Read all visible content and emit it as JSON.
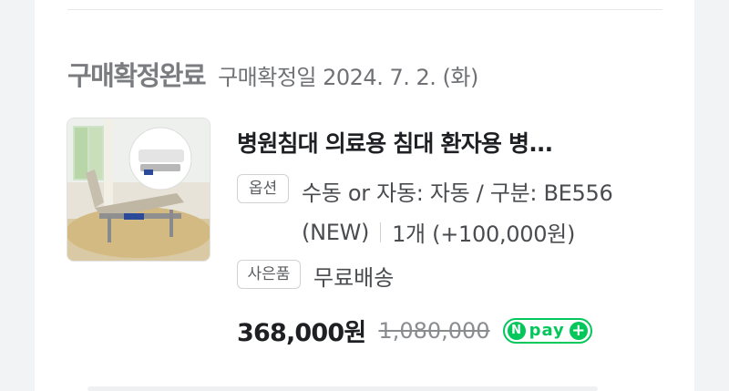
{
  "order": {
    "status": "구매확정완료",
    "date_label": "구매확정일 2024. 7. 2. (화)"
  },
  "product": {
    "title": "병원침대 의료용 침대 환자용 병...",
    "option_chip": "옵션",
    "option_line1": "수동 or 자동: 자동 / 구분: BE556",
    "option_line2": "(NEW)",
    "quantity": "1개 (+100,000원)",
    "gift_chip": "사은품",
    "gift": "무료배송",
    "price": "368,000원",
    "original_price": "1,080,000",
    "image_icon": "hospital-bed-photo"
  },
  "npay": {
    "n": "N",
    "pay": "pay",
    "plus": "+",
    "color": "#03c75a"
  }
}
